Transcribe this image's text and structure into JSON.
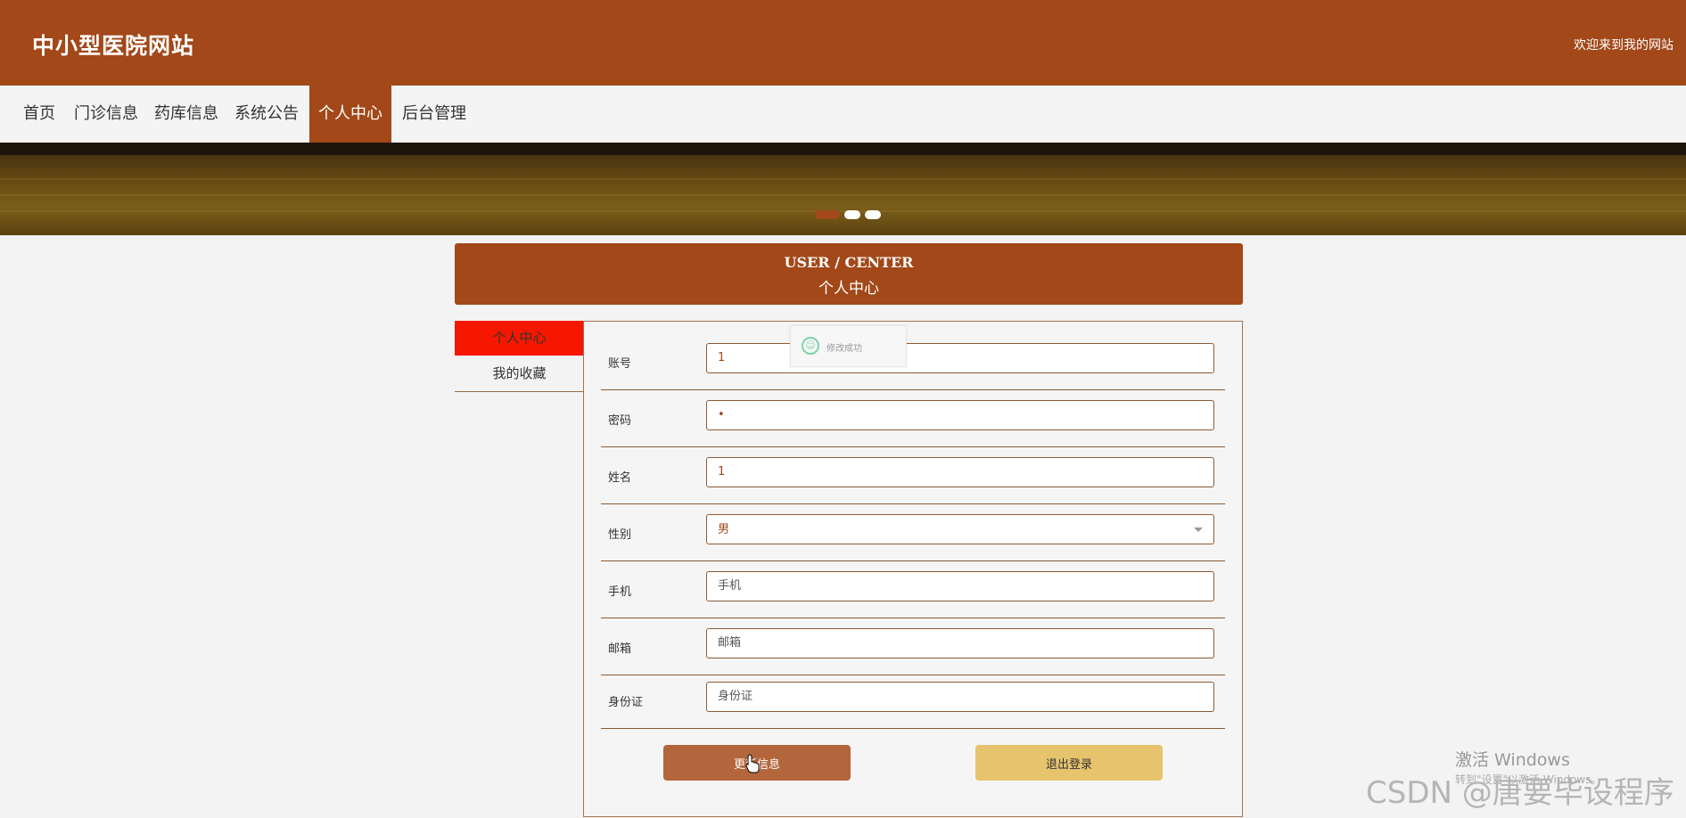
{
  "header": {
    "site_title": "中小型医院网站",
    "welcome": "欢迎来到我的网站"
  },
  "nav": {
    "items": [
      "首页",
      "门诊信息",
      "药库信息",
      "系统公告",
      "个人中心",
      "后台管理"
    ],
    "active_index": 4
  },
  "banner": {
    "slides": 3,
    "active_slide": 0
  },
  "user_center": {
    "title_en": "USER / CENTER",
    "title_cn": "个人中心"
  },
  "sidebar": {
    "items": [
      "个人中心",
      "我的收藏"
    ]
  },
  "toast": {
    "text": "修改成功"
  },
  "form": {
    "fields": [
      {
        "label": "账号",
        "value": "1",
        "placeholder": ""
      },
      {
        "label": "密码",
        "value": "•",
        "placeholder": ""
      },
      {
        "label": "姓名",
        "value": "1",
        "placeholder": ""
      },
      {
        "label": "性别",
        "value": "男",
        "placeholder": ""
      },
      {
        "label": "手机",
        "value": "",
        "placeholder": "手机"
      },
      {
        "label": "邮箱",
        "value": "",
        "placeholder": "邮箱"
      },
      {
        "label": "身份证",
        "value": "",
        "placeholder": "身份证"
      }
    ],
    "update_label": "更新信息",
    "logout_label": "退出登录"
  },
  "overlay": {
    "windows_activate": "激活 Windows",
    "windows_activate_sub": "转到\"设置\"以激活 Windows。",
    "watermark": "CSDN @唐要毕设程序"
  },
  "colors": {
    "brand": "#a24819",
    "sidebar_active": "#f51700",
    "update_button": "#b3663c",
    "logout_button": "#e6c46e"
  }
}
